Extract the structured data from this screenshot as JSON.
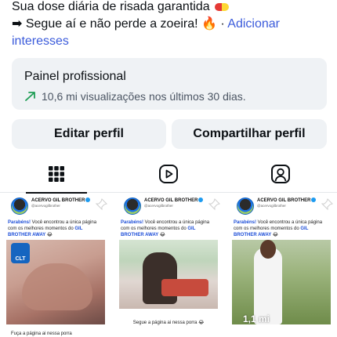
{
  "bio": {
    "line1_text": "Sua dose diária de risada garantida",
    "line2_arrow": "➡",
    "line2_text": " Segue aí e não perde a zoeira! ",
    "line2_fire": "🔥",
    "line2_sep": " · ",
    "line2_link": "Adicionar",
    "line3_link": "interesses"
  },
  "panel": {
    "title": "Painel profissional",
    "subtitle": "10,6 mi visualizações nos últimos 30 dias."
  },
  "buttons": {
    "edit": "Editar perfil",
    "share": "Compartilhar perfil"
  },
  "tabs": [
    {
      "name": "grid",
      "icon": "grid-icon",
      "active": true
    },
    {
      "name": "reels",
      "icon": "reels-icon",
      "active": false
    },
    {
      "name": "tagged",
      "icon": "tagged-icon",
      "active": false
    }
  ],
  "posts": [
    {
      "account": "ACERVO GIL BROTHER",
      "handle": "@acervogilbrother",
      "text_pre": "Parabéns!",
      "text_mid": " Você encontrou a única página com os melhores momentos do ",
      "text_hl": "GIL BROTHER AWAY",
      "text_emoji": " 😂",
      "badge": "CLT",
      "footer": "Fuça a página ai nessa porra"
    },
    {
      "account": "ACERVO GIL BROTHER",
      "handle": "@acervogilbrother",
      "text_pre": "Parabéns!",
      "text_mid": " Você encontrou a única página com os melhores momentos do ",
      "text_hl": "GIL BROTHER AWAY",
      "text_emoji": " 😂",
      "footer": "Segue a página ai nessa porra 😂"
    },
    {
      "account": "ACERVO GIL BROTHER",
      "handle": "@acervogilbrother",
      "text_pre": "Parabéns!",
      "text_mid": " Você encontrou a única página com os melhores momentos do ",
      "text_hl": "GIL BROTHER AWAY",
      "text_emoji": " 😂",
      "views": "1,1 mi"
    }
  ],
  "colors": {
    "accent": "#3b5bdb",
    "panel_bg": "#eff2f5",
    "trend": "#1f9d55"
  }
}
